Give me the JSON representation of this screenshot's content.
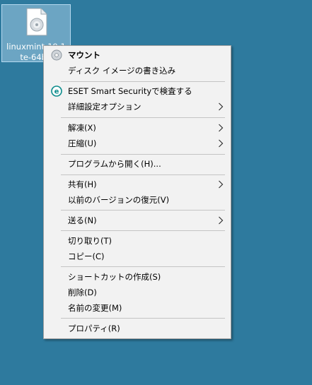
{
  "desktop": {
    "file_icon": "disc-image-file-icon",
    "file_label_line1": "linuxmint-19.1",
    "file_label_line2": "te-64bit"
  },
  "menu": {
    "items": [
      {
        "label": "マウント",
        "bold": true,
        "icon": "disc-icon"
      },
      {
        "label": "ディスク イメージの書き込み"
      },
      {
        "label": "ESET Smart Securityで検査する",
        "icon": "eset-icon"
      },
      {
        "label": "詳細設定オプション",
        "submenu": true
      },
      {
        "label": "解凍(X)",
        "submenu": true
      },
      {
        "label": "圧縮(U)",
        "submenu": true
      },
      {
        "label": "プログラムから開く(H)..."
      },
      {
        "label": "共有(H)",
        "submenu": true
      },
      {
        "label": "以前のバージョンの復元(V)"
      },
      {
        "label": "送る(N)",
        "submenu": true
      },
      {
        "label": "切り取り(T)"
      },
      {
        "label": "コピー(C)"
      },
      {
        "label": "ショートカットの作成(S)"
      },
      {
        "label": "削除(D)"
      },
      {
        "label": "名前の変更(M)"
      },
      {
        "label": "プロパティ(R)"
      }
    ]
  }
}
